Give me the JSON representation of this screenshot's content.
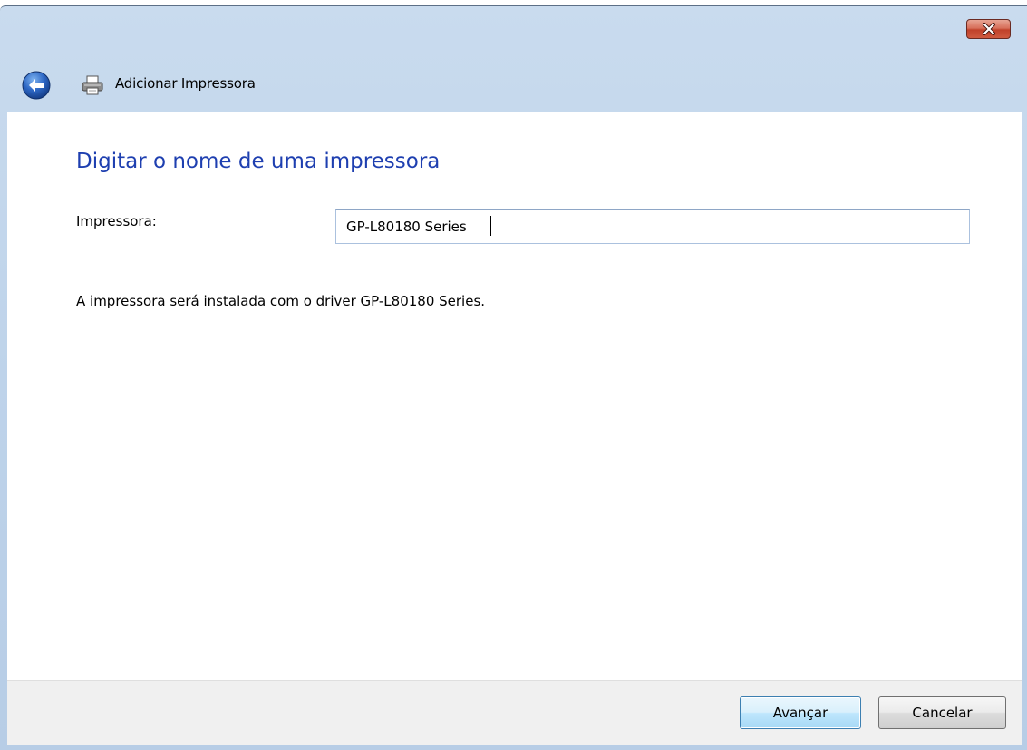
{
  "window": {
    "title": "Adicionar Impressora",
    "close_icon": "close-icon",
    "back_icon": "back-arrow-icon",
    "printer_icon": "printer-icon"
  },
  "main": {
    "heading": "Digitar o nome de uma impressora",
    "printer_field": {
      "label": "Impressora:",
      "value": "GP-L80180 Series"
    },
    "info_text": "A impressora será instalada com o driver GP-L80180 Series."
  },
  "footer": {
    "next_label": "Avançar",
    "cancel_label": "Cancelar"
  },
  "colors": {
    "heading": "#1e3fb0",
    "titlebar": "#bed3ea",
    "close_button": "#c0412a"
  }
}
